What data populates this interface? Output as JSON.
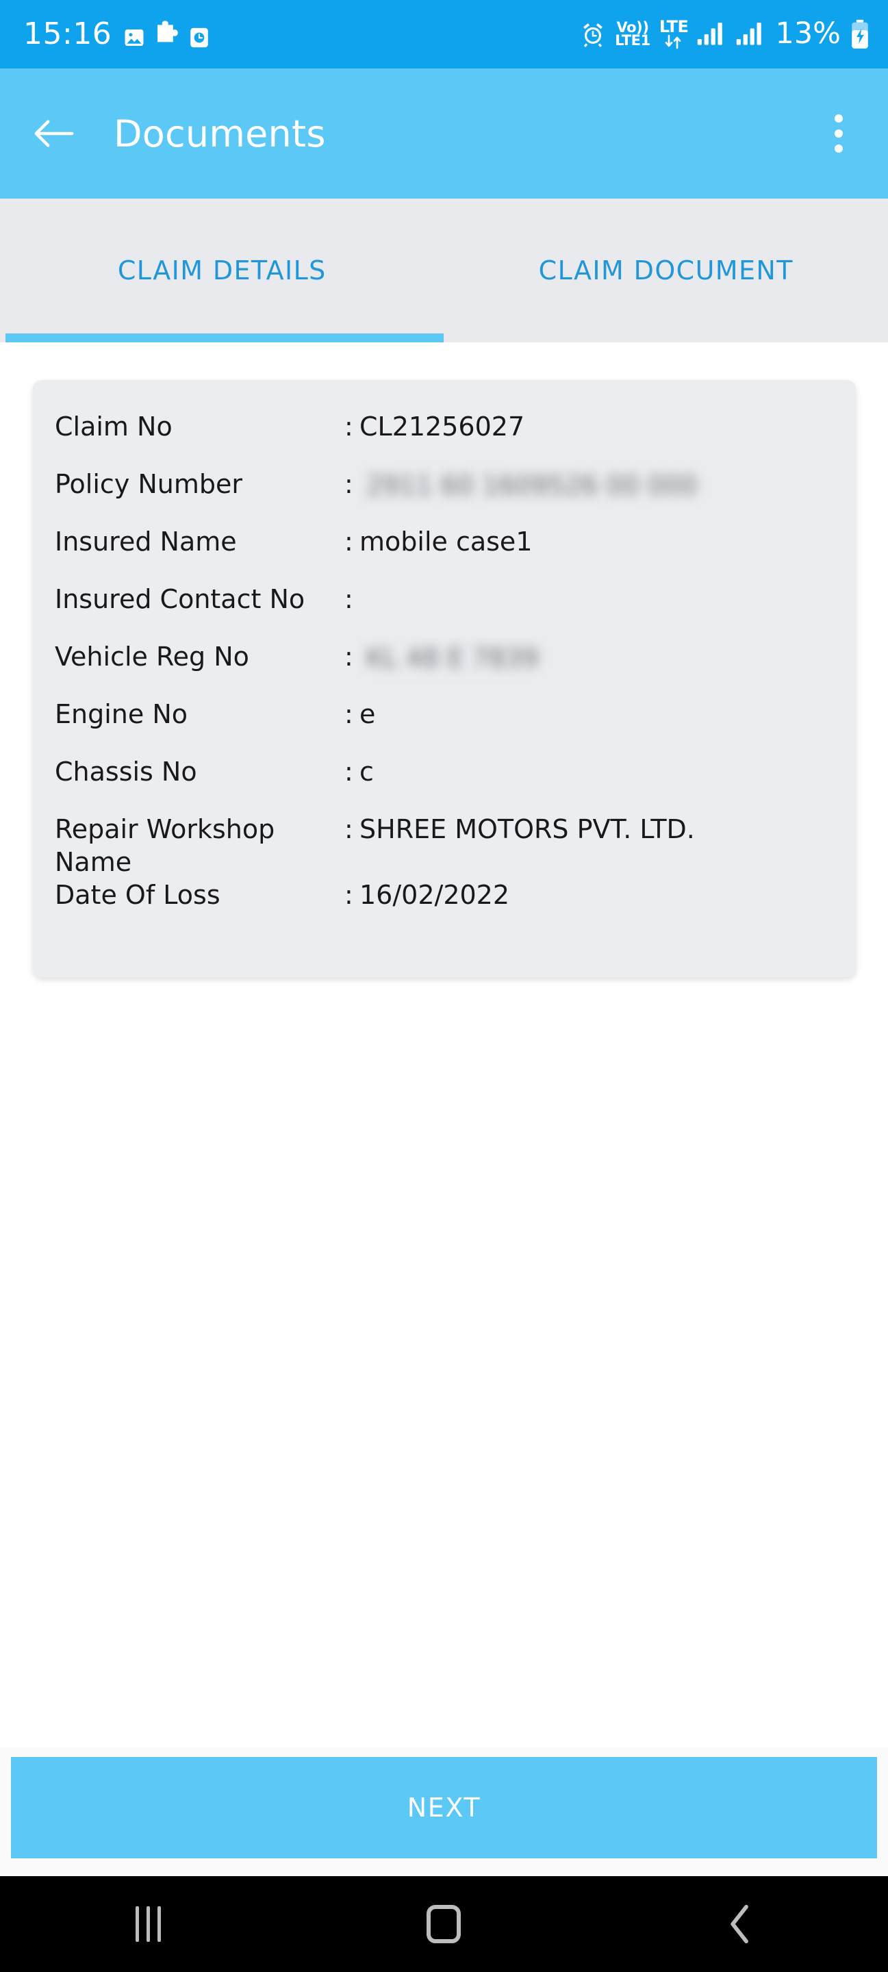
{
  "status_bar": {
    "time": "15:16",
    "left_icons": [
      "image-icon",
      "puzzle-icon",
      "clock-icon"
    ],
    "alarm_icon": "alarm-icon",
    "volte_top": "Vo))",
    "volte_bottom": "LTE1",
    "lte_label": "LTE",
    "data_arrows": "↓↑",
    "signal_icons": [
      "signal-bars-sim1",
      "signal-bars-sim2"
    ],
    "battery_percent": "13%",
    "battery_icon": "battery-charging-icon",
    "bg_color": "#0FA3EE"
  },
  "app_bar": {
    "back_icon": "back-arrow-icon",
    "title": "Documents",
    "overflow_icon": "overflow-menu-icon",
    "bg_color": "#5BC8F5"
  },
  "tabs": {
    "items": [
      {
        "label": "CLAIM DETAILS",
        "active": true
      },
      {
        "label": "CLAIM DOCUMENT",
        "active": false
      }
    ],
    "indicator_color": "#5BC8F5",
    "text_color": "#2196D9",
    "bg_color": "#E8EAEE"
  },
  "claim_details": {
    "card_bg": "#EBEDF0",
    "separator": ":",
    "rows": [
      {
        "label": "Claim No",
        "value": "CL21256027",
        "redacted": false
      },
      {
        "label": "Policy Number",
        "value": "2911 60 1609526 00 000",
        "redacted": true
      },
      {
        "label": "Insured Name",
        "value": "mobile case1",
        "redacted": false
      },
      {
        "label": "Insured Contact No",
        "value": "",
        "redacted": false
      },
      {
        "label": "Vehicle Reg No",
        "value": "KL 48 E 7839",
        "redacted": true
      },
      {
        "label": "Engine No",
        "value": "e",
        "redacted": false
      },
      {
        "label": "Chassis No",
        "value": "c",
        "redacted": false
      },
      {
        "label": "Repair Workshop Name",
        "value": "SHREE MOTORS PVT. LTD.",
        "redacted": false
      },
      {
        "label": "Date Of Loss",
        "value": "16/02/2022",
        "redacted": false
      }
    ]
  },
  "footer": {
    "next_label": "NEXT",
    "next_color": "#5BC8F5"
  },
  "nav_bar": {
    "recents_icon": "recents-icon",
    "home_icon": "home-icon",
    "back_icon": "nav-back-icon",
    "bg_color": "#000000"
  }
}
